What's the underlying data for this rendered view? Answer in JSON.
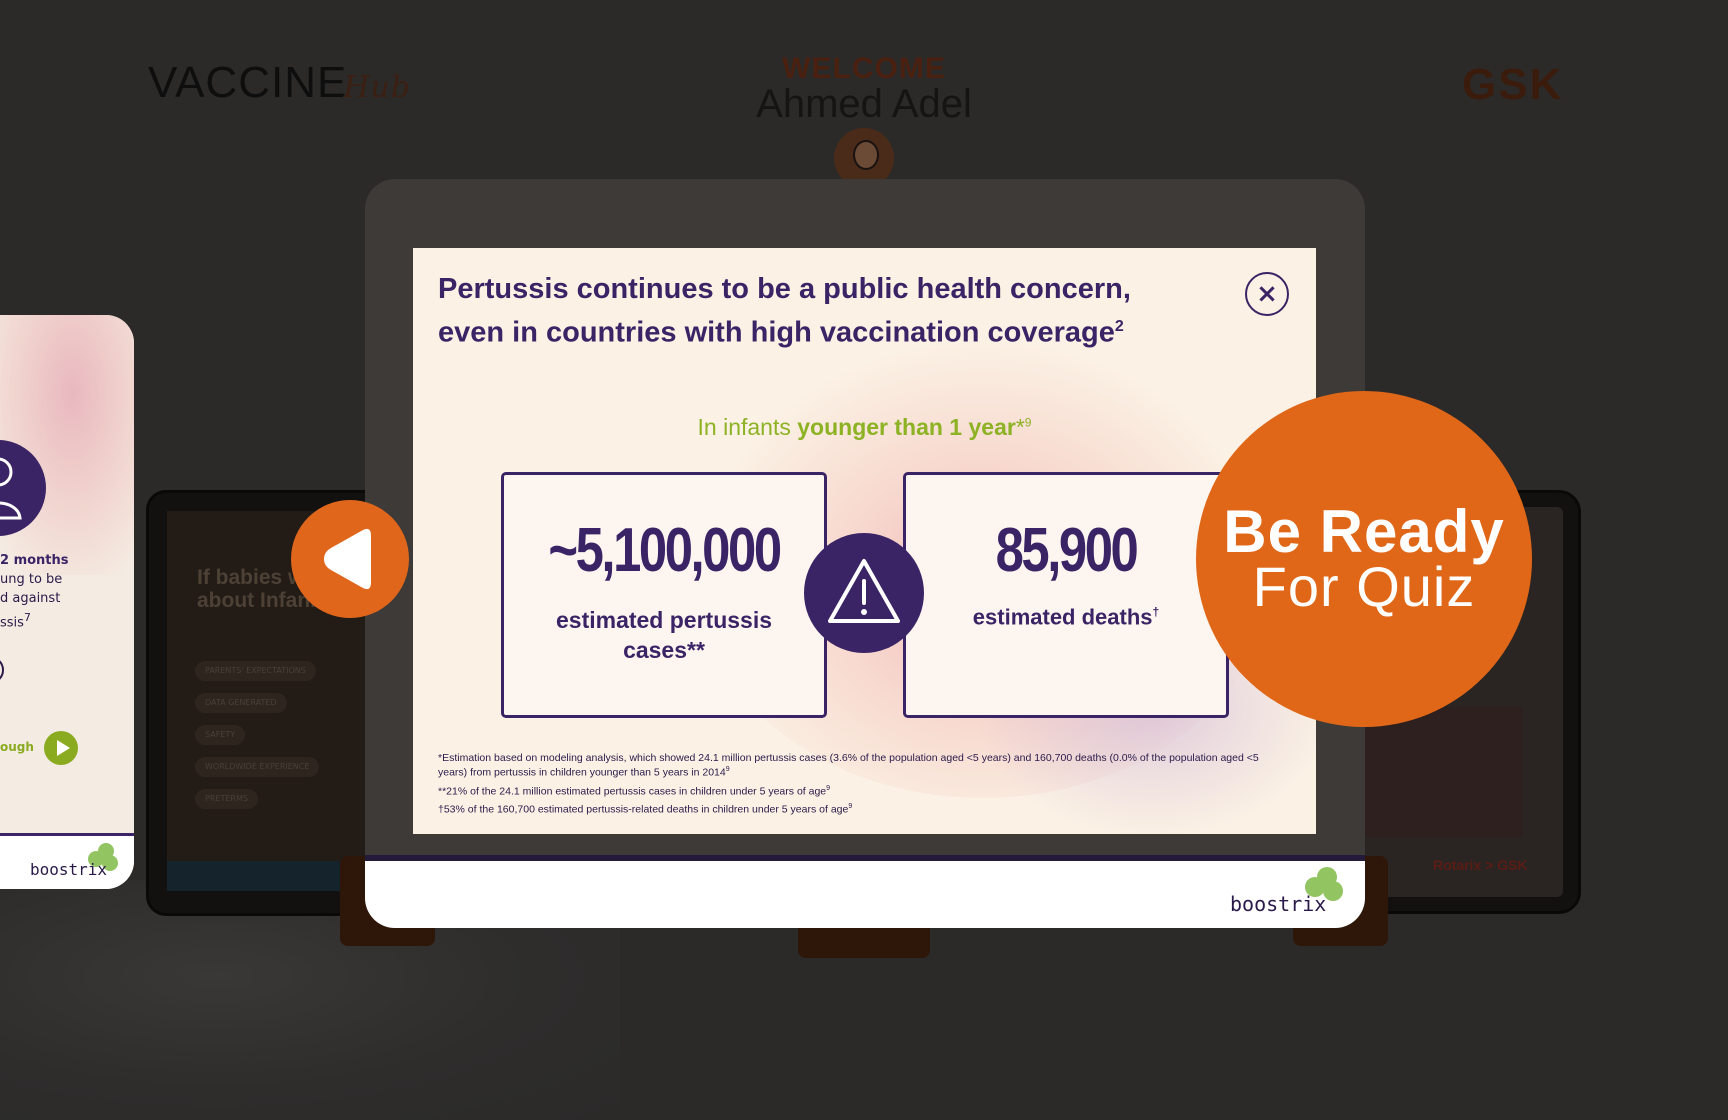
{
  "header": {
    "logo_main": "VACCINE",
    "logo_script": "Hub",
    "welcome": "WELCOME",
    "user_name": "Ahmed Adel",
    "partner_logo": "GSK"
  },
  "left_card": {
    "line1": "2 months",
    "line2": "ung to be",
    "line3": "d against",
    "line4": "ssis",
    "line4_sup": "7",
    "cough_label": "ough",
    "brand": "boostrix"
  },
  "tablet_left": {
    "headline": "If babies wouldn't t about Infanrix he",
    "pills": [
      "PARENTS' EXPECTATIONS",
      "DATA GENERATED",
      "SAFETY",
      "WORLDWIDE EXPERIENCE",
      "PRETERMS"
    ]
  },
  "tablet_right": {
    "logo": "Rotarix > GSK"
  },
  "modal": {
    "title_line1": "Pertussis continues to be a public health concern,",
    "title_line2": "even in countries with high vaccination coverage",
    "title_sup": "2",
    "subheading_prefix": "In infants ",
    "subheading_strong": "younger than 1 year",
    "subheading_mark": "*",
    "subheading_sup": "9",
    "stat_cases_value": "~5,100,000",
    "stat_cases_label": "estimated pertussis cases**",
    "stat_deaths_value": "85,900",
    "stat_deaths_label": "estimated deaths",
    "stat_deaths_sup": "†",
    "footnote1": "*Estimation based on modeling analysis, which showed 24.1 million pertussis cases (3.6% of the population aged <5 years) and 160,700 deaths (0.0% of the population aged <5 years) from pertussis in children younger than 5 years in 2014",
    "footnote1_sup": "9",
    "footnote2": "**21% of the 24.1 million estimated pertussis cases in children under 5 years of age",
    "footnote2_sup": "9",
    "footnote3": "†53% of the 160,700 estimated pertussis-related deaths in children under 5 years of age",
    "footnote3_sup": "9",
    "close_symbol": "×"
  },
  "device": {
    "brand": "boostrix"
  },
  "quiz_badge": {
    "line1": "Be Ready",
    "line2": "For Quiz"
  },
  "icons": {
    "close": "close-icon",
    "prev": "previous-arrow-icon",
    "warning": "warning-triangle-icon",
    "play": "play-icon"
  },
  "colors": {
    "brand_purple": "#3b2466",
    "accent_orange": "#e06718",
    "accent_green": "#8db224",
    "modal_bg": "#fbf1e4",
    "page_bg": "#2b2a29"
  }
}
